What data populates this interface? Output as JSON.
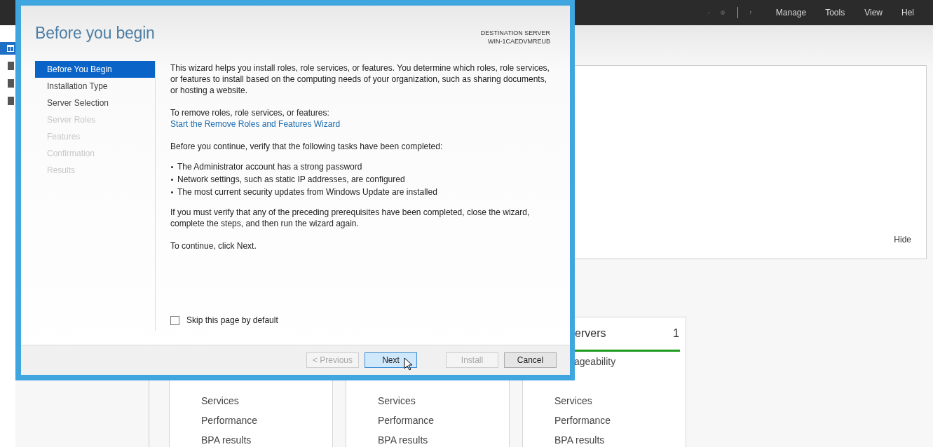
{
  "server_manager": {
    "menu": [
      "Manage",
      "Tools",
      "View",
      "Hel"
    ],
    "nav_icons": [
      {
        "selected": true
      },
      {
        "selected": false
      },
      {
        "selected": false
      },
      {
        "selected": false
      }
    ],
    "welcome_panel": {
      "hide_link": "Hide"
    },
    "tiles": [
      {
        "items": [
          {
            "kind": "item",
            "text": "Services"
          },
          {
            "kind": "item",
            "text": "Performance"
          },
          {
            "kind": "item",
            "text": "BPA results"
          }
        ]
      },
      {
        "items": [
          {
            "kind": "item",
            "text": "Services"
          },
          {
            "kind": "item",
            "text": "Performance"
          },
          {
            "kind": "item",
            "text": "BPA results"
          }
        ]
      },
      {
        "title": "ervers",
        "count": "1",
        "items": [
          {
            "kind": "clipped",
            "text": "ageability"
          },
          {
            "kind": "item",
            "text": "Services"
          },
          {
            "kind": "item",
            "text": "Performance"
          },
          {
            "kind": "item",
            "text": "BPA results"
          }
        ]
      }
    ]
  },
  "wizard": {
    "title": "Before you begin",
    "destination_label": "DESTINATION SERVER",
    "destination_server": "WIN-1CAEDVMREUB",
    "steps": [
      {
        "label": "Before You Begin",
        "selected": true,
        "disabled": false
      },
      {
        "label": "Installation Type",
        "selected": false,
        "disabled": false
      },
      {
        "label": "Server Selection",
        "selected": false,
        "disabled": false
      },
      {
        "label": "Server Roles",
        "selected": false,
        "disabled": true
      },
      {
        "label": "Features",
        "selected": false,
        "disabled": true
      },
      {
        "label": "Confirmation",
        "selected": false,
        "disabled": true
      },
      {
        "label": "Results",
        "selected": false,
        "disabled": true
      }
    ],
    "content": [
      {
        "kind": "paragraph",
        "text": "This wizard helps you install roles, role services, or features. You determine which roles, role services, or features to install based on the computing needs of your organization, such as sharing documents, or hosting a website."
      },
      {
        "kind": "paragraph",
        "text": "To remove roles, role services, or features:"
      },
      {
        "kind": "link",
        "text": "Start the Remove Roles and Features Wizard"
      },
      {
        "kind": "paragraph",
        "text": "Before you continue, verify that the following tasks have been completed:"
      },
      {
        "kind": "bullets",
        "items": [
          "The Administrator account has a strong password",
          "Network settings, such as static IP addresses, are configured",
          "The most current security updates from Windows Update are installed"
        ]
      },
      {
        "kind": "paragraph",
        "text": "If you must verify that any of the preceding prerequisites have been completed, close the wizard, complete the steps, and then run the wizard again."
      },
      {
        "kind": "paragraph",
        "text": "To continue, click Next."
      }
    ],
    "skip_checkbox": {
      "label": "Skip this page by default",
      "checked": false
    },
    "buttons": [
      {
        "label": "< Previous",
        "disabled": true,
        "focused": false
      },
      {
        "label": "Next",
        "disabled": false,
        "focused": true
      },
      {
        "label": "Install",
        "disabled": true,
        "focused": false
      },
      {
        "label": "Cancel",
        "disabled": false,
        "focused": false
      }
    ]
  }
}
